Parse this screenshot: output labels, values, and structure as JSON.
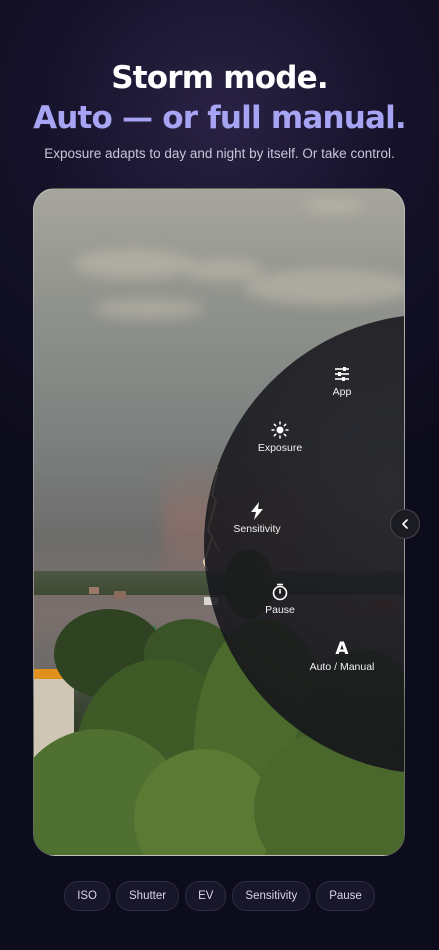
{
  "headline": {
    "line1": "Storm mode.",
    "line2": "Auto — or full manual.",
    "subtitle": "Exposure adapts to day and night by itself. Or take control."
  },
  "controls": [
    {
      "id": "app",
      "label": "App",
      "icon": "sliders-icon"
    },
    {
      "id": "exposure",
      "label": "Exposure",
      "icon": "sun-icon"
    },
    {
      "id": "sensitivity",
      "label": "Sensitivity",
      "icon": "lightning-icon"
    },
    {
      "id": "pause",
      "label": "Pause",
      "icon": "timer-icon"
    },
    {
      "id": "auto_manual",
      "label": "Auto / Manual",
      "icon": "letter-a-icon",
      "glyph": "A"
    }
  ],
  "chips": [
    "ISO",
    "Shutter",
    "EV",
    "Sensitivity",
    "Pause"
  ],
  "colors": {
    "accent": "#a8a4f4",
    "background": "#0d0c1c"
  }
}
